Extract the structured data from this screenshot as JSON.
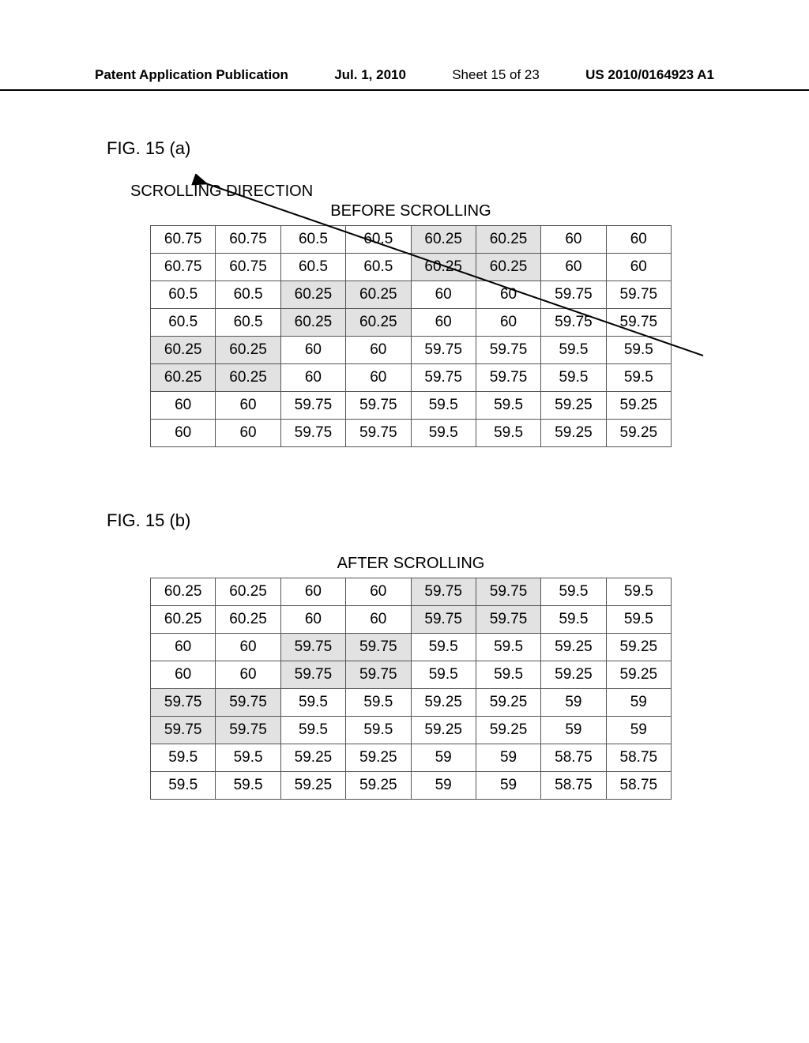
{
  "header": {
    "publication": "Patent Application Publication",
    "date": "Jul. 1, 2010",
    "sheet": "Sheet 15 of 23",
    "docnum": "US 2010/0164923 A1"
  },
  "fig_a": {
    "label": "FIG. 15 (a)",
    "scroll_dir": "SCROLLING DIRECTION",
    "caption": "BEFORE SCROLLING"
  },
  "fig_b": {
    "label": "FIG. 15 (b)",
    "caption": "AFTER SCROLLING"
  },
  "chart_data": [
    {
      "type": "table",
      "title": "BEFORE SCROLLING",
      "rows": [
        [
          "60.75",
          "60.75",
          "60.5",
          "60.5",
          "60.25",
          "60.25",
          "60",
          "60"
        ],
        [
          "60.75",
          "60.75",
          "60.5",
          "60.5",
          "60.25",
          "60.25",
          "60",
          "60"
        ],
        [
          "60.5",
          "60.5",
          "60.25",
          "60.25",
          "60",
          "60",
          "59.75",
          "59.75"
        ],
        [
          "60.5",
          "60.5",
          "60.25",
          "60.25",
          "60",
          "60",
          "59.75",
          "59.75"
        ],
        [
          "60.25",
          "60.25",
          "60",
          "60",
          "59.75",
          "59.75",
          "59.5",
          "59.5"
        ],
        [
          "60.25",
          "60.25",
          "60",
          "60",
          "59.75",
          "59.75",
          "59.5",
          "59.5"
        ],
        [
          "60",
          "60",
          "59.75",
          "59.75",
          "59.5",
          "59.5",
          "59.25",
          "59.25"
        ],
        [
          "60",
          "60",
          "59.75",
          "59.75",
          "59.5",
          "59.5",
          "59.25",
          "59.25"
        ]
      ],
      "shaded": [
        [
          0,
          0,
          0,
          0,
          1,
          1,
          0,
          0
        ],
        [
          0,
          0,
          0,
          0,
          1,
          1,
          0,
          0
        ],
        [
          0,
          0,
          1,
          1,
          0,
          0,
          0,
          0
        ],
        [
          0,
          0,
          1,
          1,
          0,
          0,
          0,
          0
        ],
        [
          1,
          1,
          0,
          0,
          0,
          0,
          0,
          0
        ],
        [
          1,
          1,
          0,
          0,
          0,
          0,
          0,
          0
        ],
        [
          0,
          0,
          0,
          0,
          0,
          0,
          0,
          0
        ],
        [
          0,
          0,
          0,
          0,
          0,
          0,
          0,
          0
        ]
      ]
    },
    {
      "type": "table",
      "title": "AFTER SCROLLING",
      "rows": [
        [
          "60.25",
          "60.25",
          "60",
          "60",
          "59.75",
          "59.75",
          "59.5",
          "59.5"
        ],
        [
          "60.25",
          "60.25",
          "60",
          "60",
          "59.75",
          "59.75",
          "59.5",
          "59.5"
        ],
        [
          "60",
          "60",
          "59.75",
          "59.75",
          "59.5",
          "59.5",
          "59.25",
          "59.25"
        ],
        [
          "60",
          "60",
          "59.75",
          "59.75",
          "59.5",
          "59.5",
          "59.25",
          "59.25"
        ],
        [
          "59.75",
          "59.75",
          "59.5",
          "59.5",
          "59.25",
          "59.25",
          "59",
          "59"
        ],
        [
          "59.75",
          "59.75",
          "59.5",
          "59.5",
          "59.25",
          "59.25",
          "59",
          "59"
        ],
        [
          "59.5",
          "59.5",
          "59.25",
          "59.25",
          "59",
          "59",
          "58.75",
          "58.75"
        ],
        [
          "59.5",
          "59.5",
          "59.25",
          "59.25",
          "59",
          "59",
          "58.75",
          "58.75"
        ]
      ],
      "shaded": [
        [
          0,
          0,
          0,
          0,
          1,
          1,
          0,
          0
        ],
        [
          0,
          0,
          0,
          0,
          1,
          1,
          0,
          0
        ],
        [
          0,
          0,
          1,
          1,
          0,
          0,
          0,
          0
        ],
        [
          0,
          0,
          1,
          1,
          0,
          0,
          0,
          0
        ],
        [
          1,
          1,
          0,
          0,
          0,
          0,
          0,
          0
        ],
        [
          1,
          1,
          0,
          0,
          0,
          0,
          0,
          0
        ],
        [
          0,
          0,
          0,
          0,
          0,
          0,
          0,
          0
        ],
        [
          0,
          0,
          0,
          0,
          0,
          0,
          0,
          0
        ]
      ]
    }
  ]
}
